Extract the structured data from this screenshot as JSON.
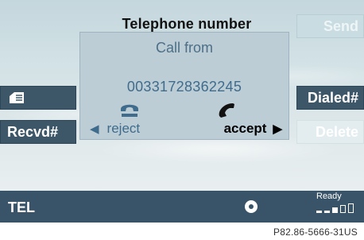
{
  "header": {
    "title": "Telephone number"
  },
  "softkeys": {
    "left": [
      {
        "label": "",
        "icon": "phonebook-icon"
      },
      {
        "label": "Recvd#"
      }
    ],
    "right": [
      {
        "label": "Send"
      },
      {
        "label": "Dialed#"
      },
      {
        "label": "Delete"
      }
    ]
  },
  "dialog": {
    "title": "Call from",
    "number": "00331728362245",
    "reject_label": "reject",
    "accept_label": "accept",
    "reject_icon": "hang-up-handset-icon",
    "accept_icon": "pick-up-handset-icon"
  },
  "status_bar": {
    "mode": "TEL",
    "status_text": "Ready",
    "disc_icon": "disc-icon",
    "signal_bars_filled": 3,
    "signal_bars_total": 5
  },
  "footer": {
    "caption": "P82.86-5666-31US"
  },
  "colors": {
    "active_key_bg": "#3d5769",
    "bar_bg": "#395468",
    "dialog_bg": "#bccdd6",
    "dialog_text": "#3f6b8c"
  }
}
